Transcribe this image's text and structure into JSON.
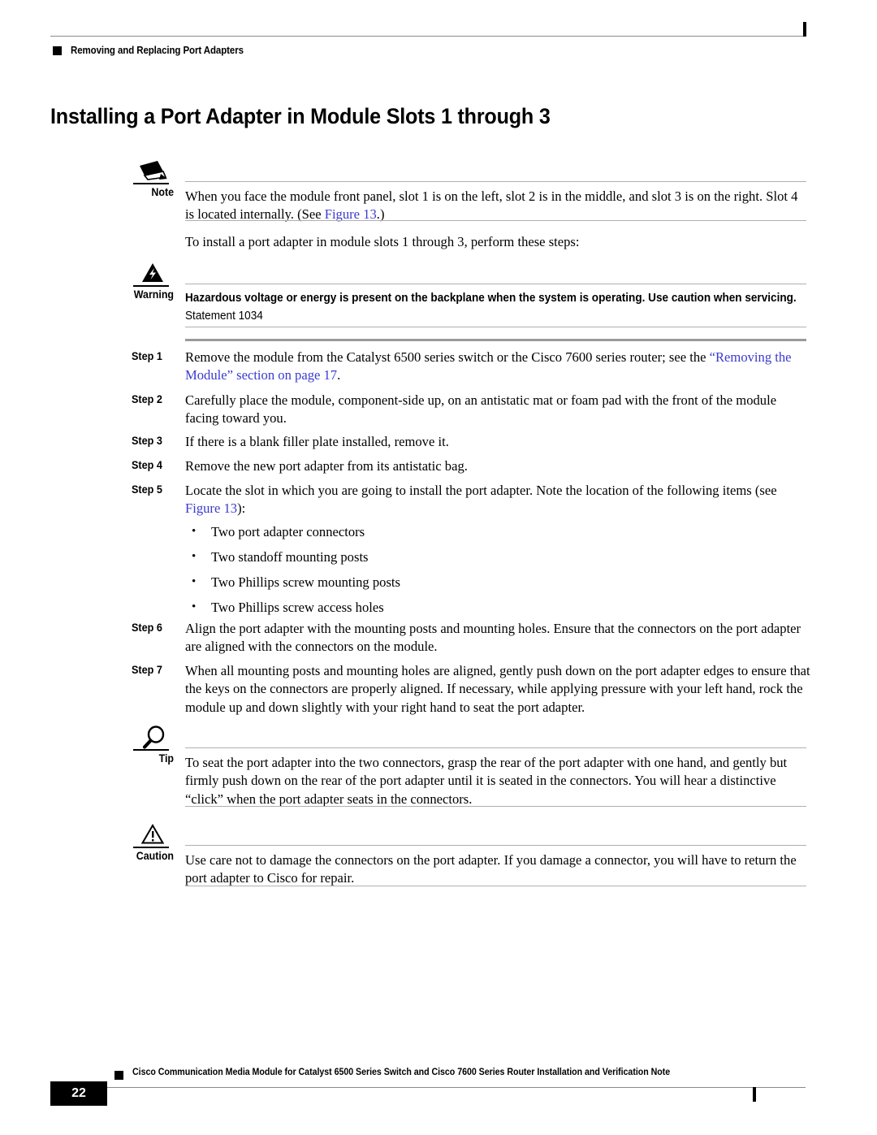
{
  "header": {
    "running_title": "Removing and Replacing Port Adapters",
    "bullet_icon": "black-square-icon"
  },
  "page_title": "Installing a Port Adapter in Module Slots 1 through 3",
  "note": {
    "label": "Note",
    "icon": "pencil-icon",
    "text_part1": "When you face the module front panel, slot 1 is on the left, slot 2 is in the middle, and slot 3 is on the right. Slot 4 is located internally. (See ",
    "link": "Figure 13",
    "text_part2": ".)"
  },
  "intro_paragraph": "To install a port adapter in module slots 1 through 3, perform these steps:",
  "warning": {
    "label": "Warning",
    "icon": "warning-lightning-triangle-icon",
    "bold_text": "Hazardous voltage or energy is present on the backplane when the system is operating. Use caution when servicing.",
    "statement": " Statement 1034"
  },
  "steps": [
    {
      "label": "Step 1",
      "text_part1": "Remove the module from the Catalyst 6500 series switch or the Cisco 7600 series router; see the ",
      "link": "“Removing the Module” section on page 17",
      "text_part2": "."
    },
    {
      "label": "Step 2",
      "text_part1": "Carefully place the module, component-side up, on an antistatic mat or foam pad with the front of the module facing toward you.",
      "link": "",
      "text_part2": ""
    },
    {
      "label": "Step 3",
      "text_part1": "If there is a blank filler plate installed, remove it.",
      "link": "",
      "text_part2": ""
    },
    {
      "label": "Step 4",
      "text_part1": "Remove the new port adapter from its antistatic bag.",
      "link": "",
      "text_part2": ""
    },
    {
      "label": "Step 5",
      "text_part1": "Locate the slot in which you are going to install the port adapter. Note the location of the following items (see ",
      "link": "Figure 13",
      "text_part2": "):"
    },
    {
      "label": "Step 6",
      "text_part1": "Align the port adapter with the mounting posts and mounting holes. Ensure that the connectors on the port adapter are aligned with the connectors on the module.",
      "link": "",
      "text_part2": ""
    },
    {
      "label": "Step 7",
      "text_part1": "When all mounting posts and mounting holes are aligned, gently push down on the port adapter edges to ensure that the keys on the connectors are properly aligned. If necessary, while applying pressure with your left hand, rock the module up and down slightly with your right hand to seat the port adapter.",
      "link": "",
      "text_part2": ""
    }
  ],
  "bullets": [
    "Two port adapter connectors",
    "Two standoff mounting posts",
    "Two Phillips screw mounting posts",
    "Two Phillips screw access holes"
  ],
  "tip": {
    "label": "Tip",
    "icon": "magnifier-icon",
    "text": "To seat the port adapter into the two connectors, grasp the rear of the port adapter with one hand, and gently but firmly push down on the rear of the port adapter until it is seated in the connectors. You will hear a distinctive “click” when the port adapter seats in the connectors."
  },
  "caution": {
    "label": "Caution",
    "icon": "caution-triangle-icon",
    "text": "Use care not to damage the connectors on the port adapter. If you damage a connector, you will have to return the port adapter to Cisco for repair."
  },
  "footer": {
    "page_number": "22",
    "bullet_icon": "black-square-icon",
    "document_title": "Cisco Communication Media Module for Catalyst 6500 Series Switch and Cisco 7600 Series Router Installation and Verification Note"
  },
  "colors": {
    "link": "#3a3ad0",
    "rule": "#b0b0b0",
    "thick_rule": "#9a9a9a",
    "ink": "#000000"
  }
}
